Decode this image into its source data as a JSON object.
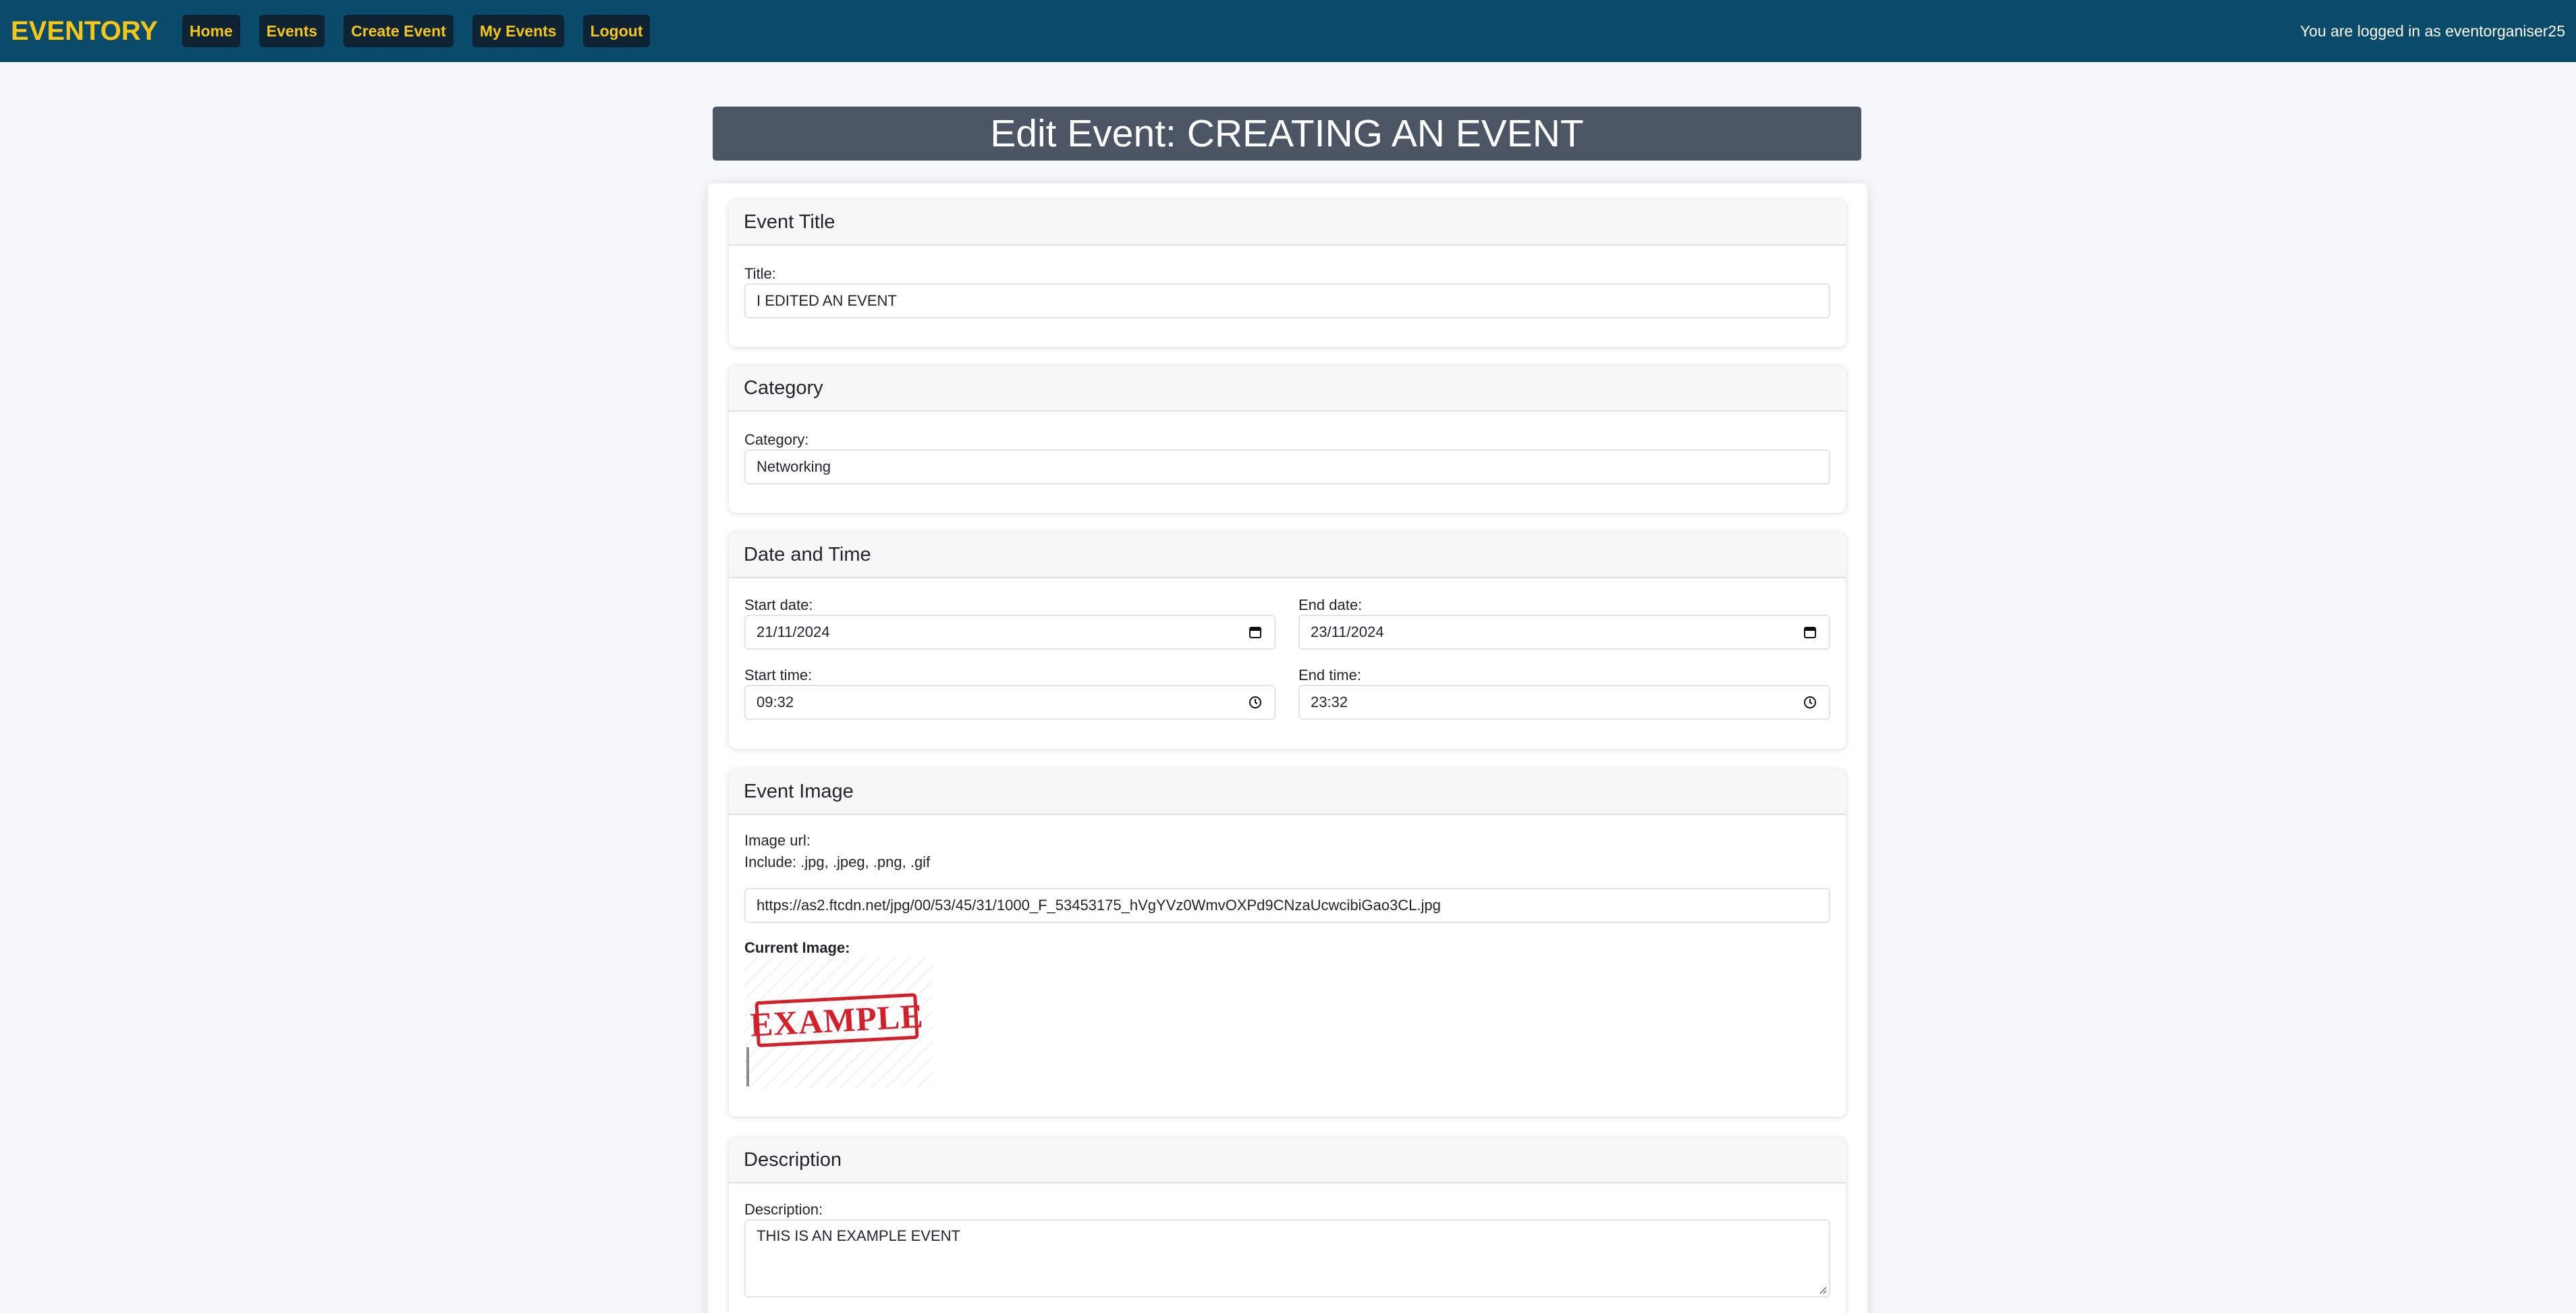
{
  "brand": "EVENTORY",
  "nav": {
    "items": [
      {
        "label": "Home"
      },
      {
        "label": "Events"
      },
      {
        "label": "Create Event"
      },
      {
        "label": "My Events"
      },
      {
        "label": "Logout"
      }
    ],
    "user_text": "You are logged in as eventorganiser25"
  },
  "page": {
    "title": "Edit Event: CREATING AN EVENT"
  },
  "sections": {
    "title": {
      "header": "Event Title",
      "label": "Title:",
      "value": "I EDITED AN EVENT"
    },
    "category": {
      "header": "Category",
      "label": "Category:",
      "value": "Networking"
    },
    "datetime": {
      "header": "Date and Time",
      "start_date_label": "Start date:",
      "start_date_value": "21/11/2024",
      "end_date_label": "End date:",
      "end_date_value": "23/11/2024",
      "start_time_label": "Start time:",
      "start_time_value": "09:32",
      "end_time_label": "End time:",
      "end_time_value": "23:32"
    },
    "image": {
      "header": "Event Image",
      "label": "Image url:",
      "hint": "Include: .jpg, .jpeg, .png, .gif",
      "value": "https://as2.ftcdn.net/jpg/00/53/45/31/1000_F_53453175_hVgYVz0WmvOXPd9CNzaUcwcibiGao3CL.jpg",
      "current_label": "Current Image:",
      "stamp_text": "EXAMPLE"
    },
    "description": {
      "header": "Description",
      "label": "Description:",
      "value": "THIS IS AN EXAMPLE EVENT"
    }
  },
  "colors": {
    "navbar": "#0a4a6a",
    "brand": "#f5c518",
    "nav_button_bg": "#0d2233",
    "title_bar": "#4b5563",
    "stamp": "#d3202a"
  },
  "icons": {
    "date": "calendar-icon",
    "time": "clock-icon",
    "resize": "resize-handle-icon"
  }
}
